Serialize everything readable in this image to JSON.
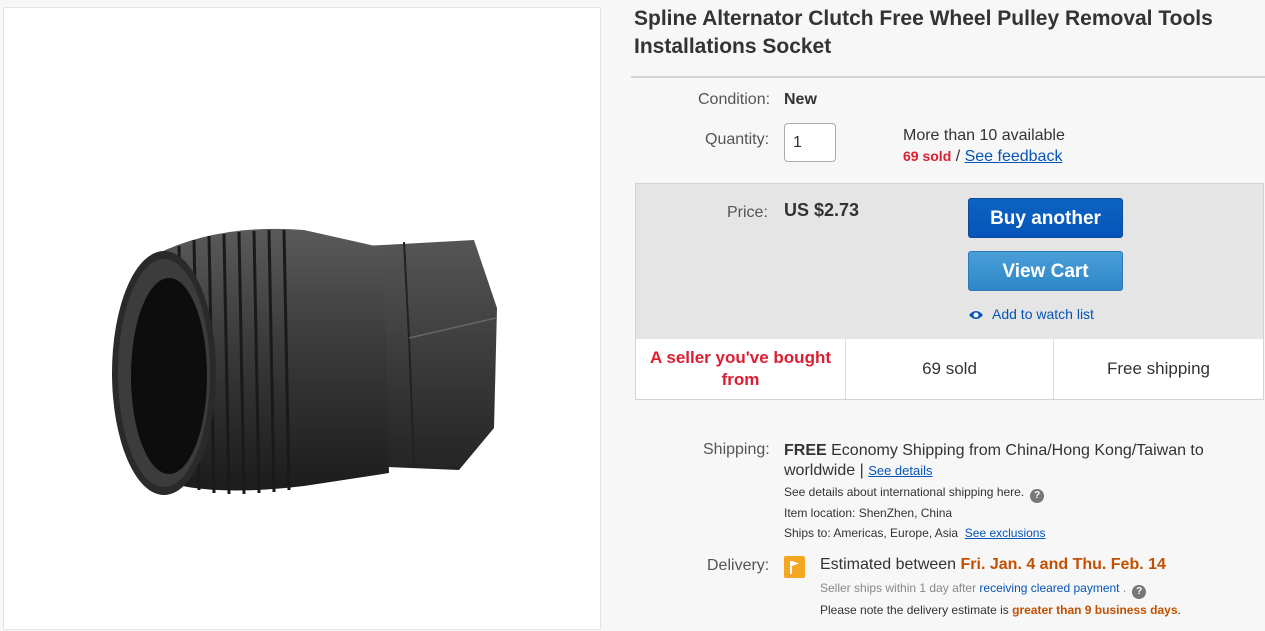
{
  "product": {
    "title": "Spline Alternator Clutch Free Wheel Pulley Removal Tools Installations Socket"
  },
  "condition": {
    "label": "Condition:",
    "value": "New"
  },
  "quantity": {
    "label": "Quantity:",
    "value": "1",
    "available": "More than 10 available",
    "sold": "69 sold",
    "separator": " / ",
    "feedback_link": "See feedback"
  },
  "price": {
    "label": "Price:",
    "value": "US $2.73"
  },
  "buttons": {
    "buy_another": "Buy another",
    "view_cart": "View Cart",
    "watch_list": "Add to watch list"
  },
  "highlights": {
    "seller": "A seller you've bought from",
    "sold": "69 sold",
    "shipping": "Free shipping"
  },
  "shipping": {
    "label": "Shipping:",
    "free": "FREE",
    "method": " Economy Shipping from China/Hong Kong/Taiwan to worldwide | ",
    "see_details": "See details",
    "intl_details": "See details about international shipping here.",
    "item_location": "Item location:  ShenZhen, China",
    "ships_to": "Ships to:  Americas, Europe, Asia",
    "see_exclusions": "See exclusions"
  },
  "delivery": {
    "label": "Delivery:",
    "estimated_prefix": "Estimated between ",
    "dates": "Fri. Jan. 4 and Thu. Feb. 14",
    "ships_within": "Seller ships within 1 day after ",
    "payment_link": "receiving cleared payment",
    "ships_within_end": " .",
    "note_prefix": "Please note the delivery estimate is ",
    "note_emphasis": "greater than 9 business days",
    "note_end": "."
  },
  "colors": {
    "accent_blue": "#0654ba",
    "sold_red": "#dd1e31",
    "delivery_orange": "#c25000",
    "flag_orange": "#f5a623"
  },
  "icons": {
    "eye": "eye-icon",
    "help": "question-mark-icon",
    "flag": "flag-icon"
  }
}
